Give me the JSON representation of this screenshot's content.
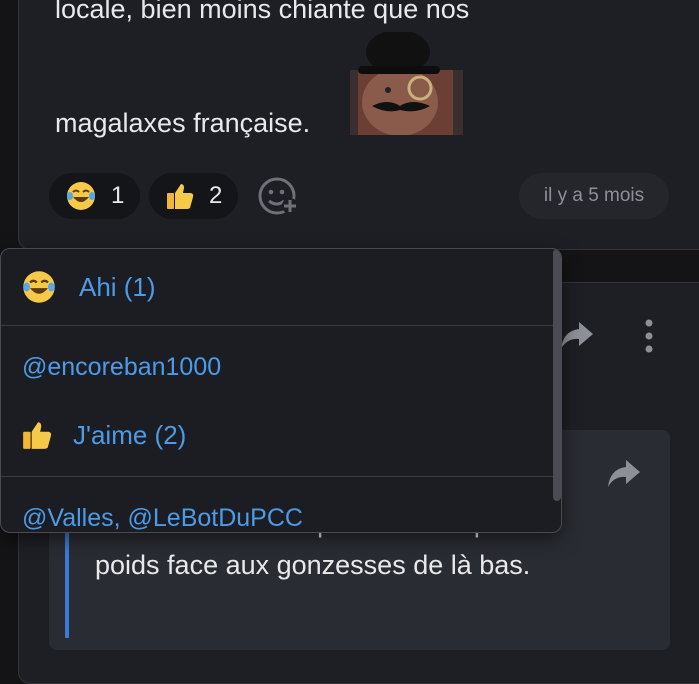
{
  "message": {
    "line1": "locale, bien moins chiante que nos",
    "line2": "magalaxes française.",
    "reactions": [
      {
        "icon": "laughing-crying-emoji-icon",
        "count": "1"
      },
      {
        "icon": "thumbs-up-icon",
        "count": "2"
      }
    ],
    "timestamp": "il y a 5 mois"
  },
  "popup": {
    "sections": [
      {
        "title": "Ahi (1)",
        "users": "@encoreban1000"
      },
      {
        "title": "J'aime (2)",
        "users": "@Valles, @LeBotDuPCC"
      }
    ]
  },
  "quote": {
    "line1": "Elle sait très bien qu'elle ne fait pas le",
    "line2": "poids face aux gonzesses de là bas."
  },
  "colors": {
    "accent": "#4c9be8",
    "card_bg": "#1e1f24",
    "page_bg": "#141417"
  }
}
